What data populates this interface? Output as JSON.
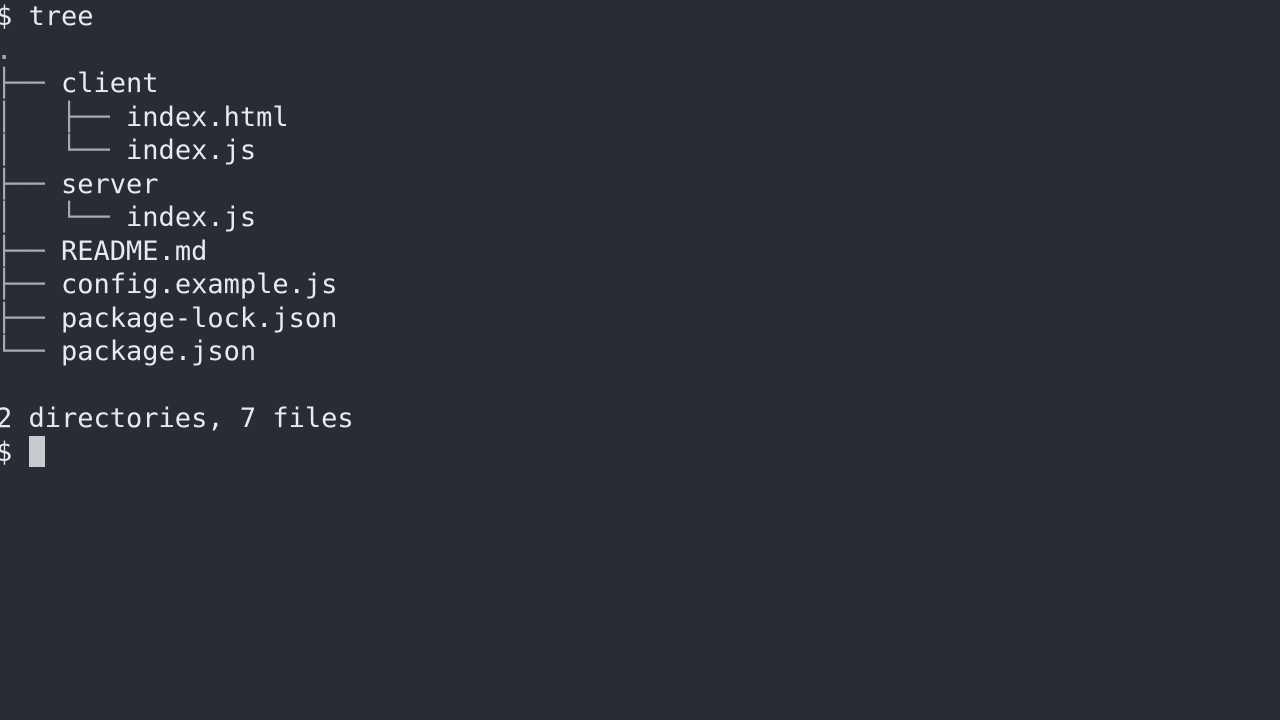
{
  "terminal": {
    "background_color": "#282c35",
    "text_color": "#e9eaee",
    "tree_line_color": "#a6acb6",
    "cursor_color": "#c9cace",
    "command_line": {
      "prompt": "$ ",
      "command": "tree"
    },
    "root": ".",
    "tree_lines": [
      {
        "glyph": "├── ",
        "name": "client"
      },
      {
        "glyph": "│   ├── ",
        "name": "index.html"
      },
      {
        "glyph": "│   └── ",
        "name": "index.js"
      },
      {
        "glyph": "├── ",
        "name": "server"
      },
      {
        "glyph": "│   └── ",
        "name": "index.js"
      },
      {
        "glyph": "├── ",
        "name": "README.md"
      },
      {
        "glyph": "├── ",
        "name": "config.example.js"
      },
      {
        "glyph": "├── ",
        "name": "package-lock.json"
      },
      {
        "glyph": "└── ",
        "name": "package.json"
      }
    ],
    "blank_line": " ",
    "summary": "2 directories, 7 files",
    "final_prompt": "$ ",
    "cursor": "block"
  }
}
